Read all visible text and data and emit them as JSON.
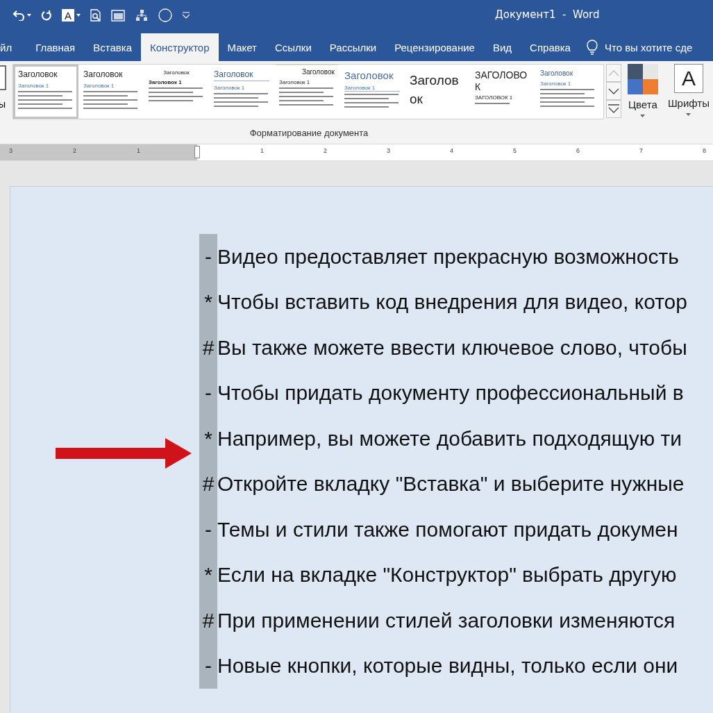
{
  "window": {
    "title": "Документ1  -  Word"
  },
  "quick_access": [
    {
      "kind": "undo",
      "dropdown": true
    },
    {
      "kind": "redo",
      "dropdown": false
    },
    {
      "kind": "font-color",
      "glyph": "A",
      "dropdown": true
    },
    {
      "kind": "preview",
      "dropdown": false
    },
    {
      "kind": "window",
      "dropdown": false
    },
    {
      "kind": "diagram",
      "dropdown": false
    },
    {
      "kind": "circle",
      "dropdown": false
    },
    {
      "kind": "customize",
      "dropdown": false
    }
  ],
  "tabs": [
    {
      "label": "йл",
      "selected": false
    },
    {
      "label": "Главная",
      "selected": false
    },
    {
      "label": "Вставка",
      "selected": false
    },
    {
      "label": "Конструктор",
      "selected": true
    },
    {
      "label": "Макет",
      "selected": false
    },
    {
      "label": "Ссылки",
      "selected": false
    },
    {
      "label": "Рассылки",
      "selected": false
    },
    {
      "label": "Рецензирование",
      "selected": false
    },
    {
      "label": "Вид",
      "selected": false
    },
    {
      "label": "Справка",
      "selected": false
    }
  ],
  "tell_me": {
    "placeholder": "Что вы хотите сде"
  },
  "ribbon": {
    "themes_label": "ы",
    "styles": [
      {
        "kind": "classic",
        "selected": true,
        "heading": "Заголовок",
        "subheading": "Заголовок 1"
      },
      {
        "kind": "classic",
        "selected": false,
        "heading": "Заголовок",
        "subheading": "Заголовок 1"
      },
      {
        "kind": "centered",
        "selected": false,
        "heading": "Заголовок",
        "subheading": "Заголовок 1"
      },
      {
        "kind": "underlined",
        "selected": false,
        "heading": "Заголовок",
        "subheading": "Заголовок 1"
      },
      {
        "kind": "lined",
        "selected": false,
        "heading": "Заголовок",
        "subheading": "Заголовок 1"
      },
      {
        "kind": "blue",
        "selected": false,
        "heading": "Заголовок",
        "subheading": "Заголовок 1"
      },
      {
        "kind": "large",
        "selected": false,
        "heading": "Заголовок"
      },
      {
        "kind": "caps",
        "selected": false,
        "heading": "ЗАГОЛОВОК",
        "subheading": "ЗАГОЛОВОК 1"
      },
      {
        "kind": "blue-small",
        "selected": false,
        "heading": "Заголовок",
        "subheading": "Заголовок 1"
      }
    ],
    "group_label": "Форматирование документа",
    "colors_label": "Цвета",
    "fonts_label": "Шрифты",
    "fonts_glyph": "A"
  },
  "ruler": {
    "ticks": [
      "3",
      "2",
      "1",
      "1",
      "2",
      "3",
      "4",
      "5",
      "6",
      "7",
      "8"
    ]
  },
  "document": {
    "lines": [
      {
        "marker": "-",
        "text": "Видео предоставляет прекрасную возможность"
      },
      {
        "marker": "*",
        "text": "Чтобы вставить код внедрения для видео, котор"
      },
      {
        "marker": "#",
        "text": "Вы также можете ввести ключевое слово, чтобы"
      },
      {
        "marker": "-",
        "text": "Чтобы придать документу профессиональный в"
      },
      {
        "marker": "*",
        "text": "Например, вы можете добавить подходящую ти"
      },
      {
        "marker": "#",
        "text": "Откройте вкладку \"Вставка\" и выберите нужные"
      },
      {
        "marker": "-",
        "text": "Темы и стили также помогают придать докумен"
      },
      {
        "marker": "*",
        "text": "Если на вкладке \"Конструктор\" выбрать другую"
      },
      {
        "marker": "#",
        "text": "При применении стилей заголовки изменяются"
      },
      {
        "marker": "-",
        "text": "Новые кнопки, которые видны, только если они"
      }
    ]
  }
}
